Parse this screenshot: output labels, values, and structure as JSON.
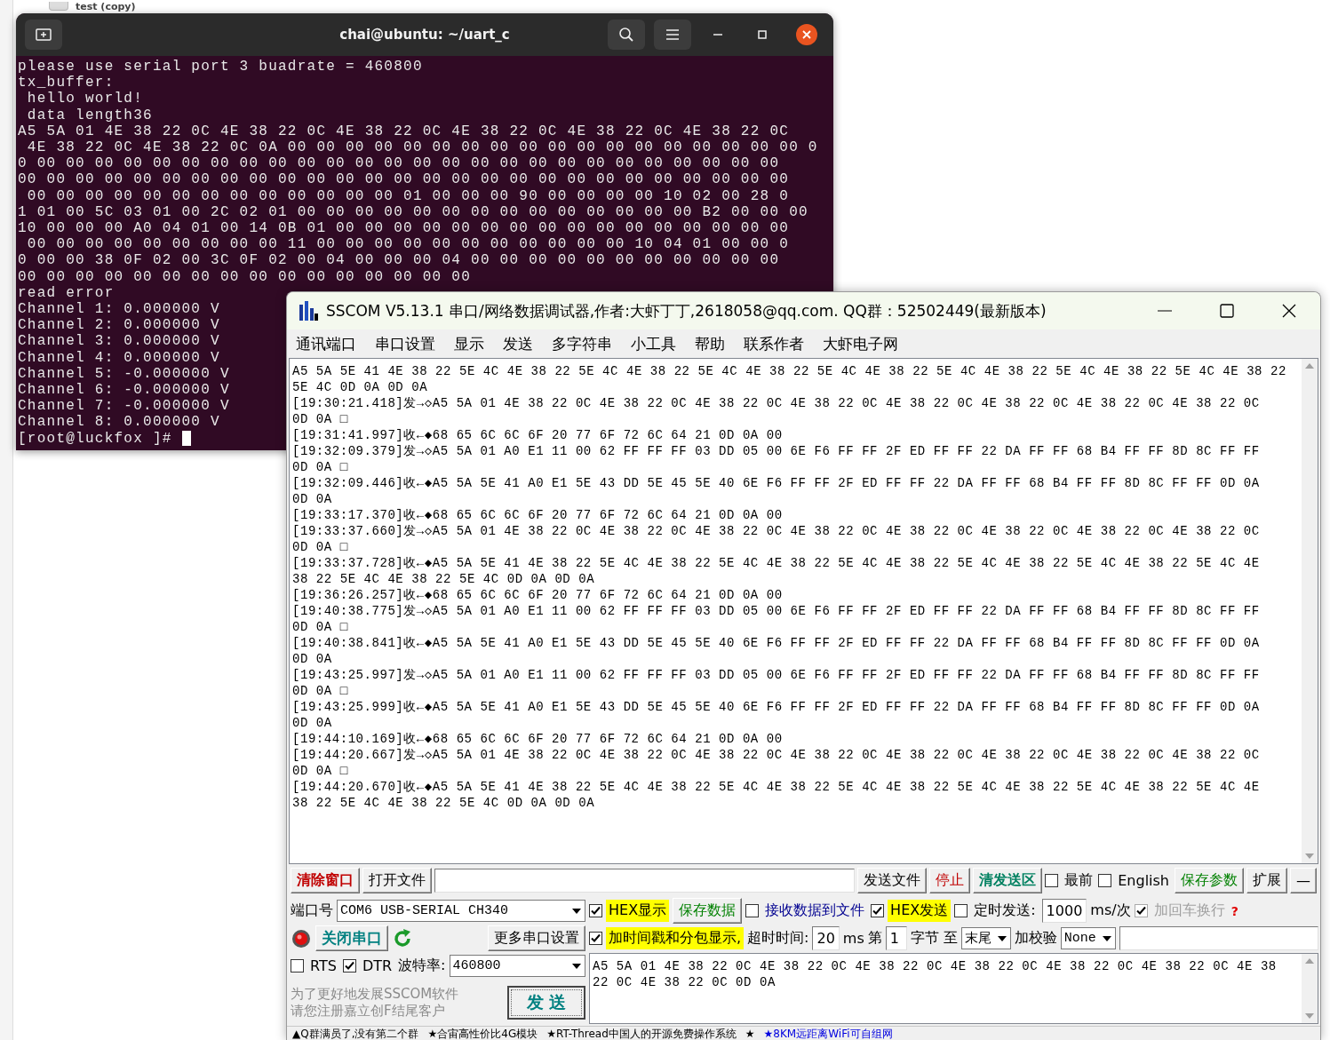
{
  "background_window": {
    "item_label": "test (copy)"
  },
  "terminal": {
    "title": "chai@ubuntu: ~/uart_c",
    "lines": [
      "please use serial port 3 buadrate = 460800",
      "tx_buffer:",
      " hello world!",
      " data length36",
      "A5 5A 01 4E 38 22 0C 4E 38 22 0C 4E 38 22 0C 4E 38 22 0C 4E 38 22 0C 4E 38 22 0C",
      " 4E 38 22 0C 4E 38 22 0C 0A 00 00 00 00 00 00 00 00 00 00 00 00 00 00 00 00 00 00 0",
      "0 00 00 00 00 00 00 00 00 00 00 00 00 00 00 00 00 00 00 00 00 00 00 00 00 00 00",
      "00 00 00 00 00 00 00 00 00 00 00 00 00 00 00 00 00 00 00 00 00 00 00 00 00 00 00",
      " 00 00 00 00 00 00 00 00 00 00 00 00 00 01 00 00 00 90 00 00 00 00 10 02 00 28 0",
      "1 01 00 5C 03 01 00 2C 02 01 00 00 00 00 00 00 00 00 00 00 00 00 00 00 B2 00 00 00",
      "10 00 00 00 A0 04 01 00 14 0B 01 00 00 00 00 00 00 00 00 00 00 00 00 00 00 00 00",
      " 00 00 00 00 00 00 00 00 00 11 00 00 00 00 00 00 00 00 00 00 00 10 04 01 00 00 0",
      "0 00 00 38 0F 02 00 3C 0F 02 00 04 00 00 00 04 00 00 00 00 00 00 00 00 00 00 00",
      "00 00 00 00 00 00 00 00 00 00 00 00 00 00 00 00",
      "read error",
      "Channel 1: 0.000000 V",
      "Channel 2: 0.000000 V",
      "Channel 3: 0.000000 V",
      "Channel 4: 0.000000 V",
      "Channel 5: -0.000000 V",
      "Channel 6: -0.000000 V",
      "Channel 7: -0.000000 V",
      "Channel 8: 0.000000 V"
    ],
    "prompt": "[root@luckfox ]#"
  },
  "sscom": {
    "title": "SSCOM V5.13.1 串口/网络数据调试器,作者:大虾丁丁,2618058@qq.com. QQ群：52502449(最新版本)",
    "menu": [
      "通讯端口",
      "串口设置",
      "显示",
      "发送",
      "多字符串",
      "小工具",
      "帮助",
      "联系作者",
      "大虾电子网"
    ],
    "log_lines": [
      "A5 5A 5E 41 4E 38 22 5E 4C 4E 38 22 5E 4C 4E 38 22 5E 4C 4E 38 22 5E 4C 4E 38 22 5E 4C 4E 38 22 5E 4C 4E 38 22 5E 4C 4E 38 22",
      "5E 4C 0D 0A 0D 0A",
      "[19:30:21.418]发→◇A5 5A 01 4E 38 22 0C 4E 38 22 0C 4E 38 22 0C 4E 38 22 0C 4E 38 22 0C 4E 38 22 0C 4E 38 22 0C 4E 38 22 0C",
      "0D 0A □",
      "[19:31:41.997]收←◆68 65 6C 6C 6F 20 77 6F 72 6C 64 21 0D 0A 00",
      "[19:32:09.379]发→◇A5 5A 01 A0 E1 11 00 62 FF FF FF 03 DD 05 00 6E F6 FF FF 2F ED FF FF 22 DA FF FF 68 B4 FF FF 8D 8C FF FF",
      "0D 0A □",
      "[19:32:09.446]收←◆A5 5A 5E 41 A0 E1 5E 43 DD 5E 45 5E 40 6E F6 FF FF 2F ED FF FF 22 DA FF FF 68 B4 FF FF 8D 8C FF FF 0D 0A",
      "0D 0A",
      "[19:33:17.370]收←◆68 65 6C 6C 6F 20 77 6F 72 6C 64 21 0D 0A 00",
      "[19:33:37.660]发→◇A5 5A 01 4E 38 22 0C 4E 38 22 0C 4E 38 22 0C 4E 38 22 0C 4E 38 22 0C 4E 38 22 0C 4E 38 22 0C 4E 38 22 0C",
      "0D 0A □",
      "[19:33:37.728]收←◆A5 5A 5E 41 4E 38 22 5E 4C 4E 38 22 5E 4C 4E 38 22 5E 4C 4E 38 22 5E 4C 4E 38 22 5E 4C 4E 38 22 5E 4C 4E",
      "38 22 5E 4C 4E 38 22 5E 4C 0D 0A 0D 0A",
      "[19:36:26.257]收←◆68 65 6C 6C 6F 20 77 6F 72 6C 64 21 0D 0A 00",
      "[19:40:38.775]发→◇A5 5A 01 A0 E1 11 00 62 FF FF FF 03 DD 05 00 6E F6 FF FF 2F ED FF FF 22 DA FF FF 68 B4 FF FF 8D 8C FF FF",
      "0D 0A □",
      "[19:40:38.841]收←◆A5 5A 5E 41 A0 E1 5E 43 DD 5E 45 5E 40 6E F6 FF FF 2F ED FF FF 22 DA FF FF 68 B4 FF FF 8D 8C FF FF 0D 0A",
      "0D 0A",
      "[19:43:25.997]发→◇A5 5A 01 A0 E1 11 00 62 FF FF FF 03 DD 05 00 6E F6 FF FF 2F ED FF FF 22 DA FF FF 68 B4 FF FF 8D 8C FF FF",
      "0D 0A □",
      "[19:43:25.999]收←◆A5 5A 5E 41 A0 E1 5E 43 DD 5E 45 5E 40 6E F6 FF FF 2F ED FF FF 22 DA FF FF 68 B4 FF FF 8D 8C FF FF 0D 0A",
      "0D 0A",
      "[19:44:10.169]收←◆68 65 6C 6C 6F 20 77 6F 72 6C 64 21 0D 0A 00",
      "[19:44:20.667]发→◇A5 5A 01 4E 38 22 0C 4E 38 22 0C 4E 38 22 0C 4E 38 22 0C 4E 38 22 0C 4E 38 22 0C 4E 38 22 0C 4E 38 22 0C",
      "0D 0A □",
      "[19:44:20.670]收←◆A5 5A 5E 41 4E 38 22 5E 4C 4E 38 22 5E 4C 4E 38 22 5E 4C 4E 38 22 5E 4C 4E 38 22 5E 4C 4E 38 22 5E 4C 4E",
      "38 22 5E 4C 4E 38 22 5E 4C 0D 0A 0D 0A"
    ],
    "toolbar": [
      {
        "kind": "button",
        "label": "清除窗口",
        "color": "#c00000",
        "bold": true
      },
      {
        "kind": "button",
        "label": "打开文件"
      },
      {
        "kind": "input"
      },
      {
        "kind": "button",
        "label": "发送文件"
      },
      {
        "kind": "button",
        "label": "停止",
        "color": "#c00000"
      },
      {
        "kind": "button",
        "label": "清发送区",
        "color": "#008060",
        "bold": true
      },
      {
        "kind": "checkbox",
        "label": "最前",
        "checked": false
      },
      {
        "kind": "checkbox",
        "label": "English",
        "checked": false
      },
      {
        "kind": "button",
        "label": "保存参数",
        "color": "#008000"
      },
      {
        "kind": "button",
        "label": "扩展"
      },
      {
        "kind": "button",
        "label": "—"
      }
    ],
    "port": {
      "label": "端口号",
      "value": "COM6 USB-SERIAL CH340"
    },
    "open_button": "关闭串口",
    "more_button": "更多串口设置",
    "rts": {
      "label": "RTS",
      "checked": false
    },
    "dtr": {
      "label": "DTR",
      "checked": true
    },
    "baud": {
      "label": "波特率:",
      "value": "460800"
    },
    "notice": [
      "为了更好地发展SSCOM软件",
      "请您注册嘉立创F结尾客户"
    ],
    "send_button": "发 送",
    "options_row_1": [
      {
        "kind": "checkbox",
        "label": "HEX显示",
        "checked": true,
        "highlighted": true,
        "disabled": false
      },
      {
        "kind": "button",
        "label": "保存数据",
        "color": "#008000"
      },
      {
        "kind": "checkbox",
        "label": "接收数据到文件",
        "checked": false,
        "highlighted": false,
        "disabled": false,
        "color": "#000090"
      },
      {
        "kind": "checkbox",
        "label": "HEX发送",
        "checked": true,
        "highlighted": true,
        "disabled": false
      },
      {
        "kind": "checkbox",
        "label": "定时发送:",
        "checked": false,
        "highlighted": false,
        "disabled": false
      },
      {
        "kind": "input",
        "value": "1000"
      },
      {
        "kind": "label",
        "text": "ms/次"
      },
      {
        "kind": "checkbox",
        "label": "加回车换行",
        "checked": true,
        "highlighted": false,
        "disabled": true
      }
    ],
    "help_mark": "?",
    "options_row_2": [
      {
        "kind": "checkbox",
        "label": "加时间戳和分包显示,",
        "checked": true,
        "highlighted": true,
        "disabled": false
      },
      {
        "kind": "label",
        "text": "超时时间:"
      },
      {
        "kind": "input",
        "value": "20"
      },
      {
        "kind": "label",
        "text": "ms"
      },
      {
        "kind": "label",
        "text": "第"
      },
      {
        "kind": "input",
        "value": "1"
      },
      {
        "kind": "label",
        "text": "字节 至"
      },
      {
        "kind": "select",
        "value": "末尾"
      },
      {
        "kind": "label",
        "text": "加校验"
      },
      {
        "kind": "select",
        "value": "None"
      },
      {
        "kind": "input"
      }
    ],
    "send_lines": [
      "A5 5A 01 4E 38 22 0C 4E 38 22 0C 4E 38 22 0C 4E 38 22 0C 4E 38 22 0C 4E 38 22 0C 4E 38",
      "22 0C 4E 38 22 0C 0D 0A"
    ],
    "status_items": [
      {
        "text": "▲Q群满员了,没有第二个群",
        "color": "#000000"
      },
      {
        "text": "★合宙高性价比4G模块",
        "color": "#000000"
      },
      {
        "text": "★RT-Thread中国人的开源免费操作系统",
        "color": "#000000"
      },
      {
        "text": "★",
        "color": "#000000"
      },
      {
        "text": "★8KM远距离WiFi可自组网",
        "color": "#0000e0"
      }
    ]
  }
}
